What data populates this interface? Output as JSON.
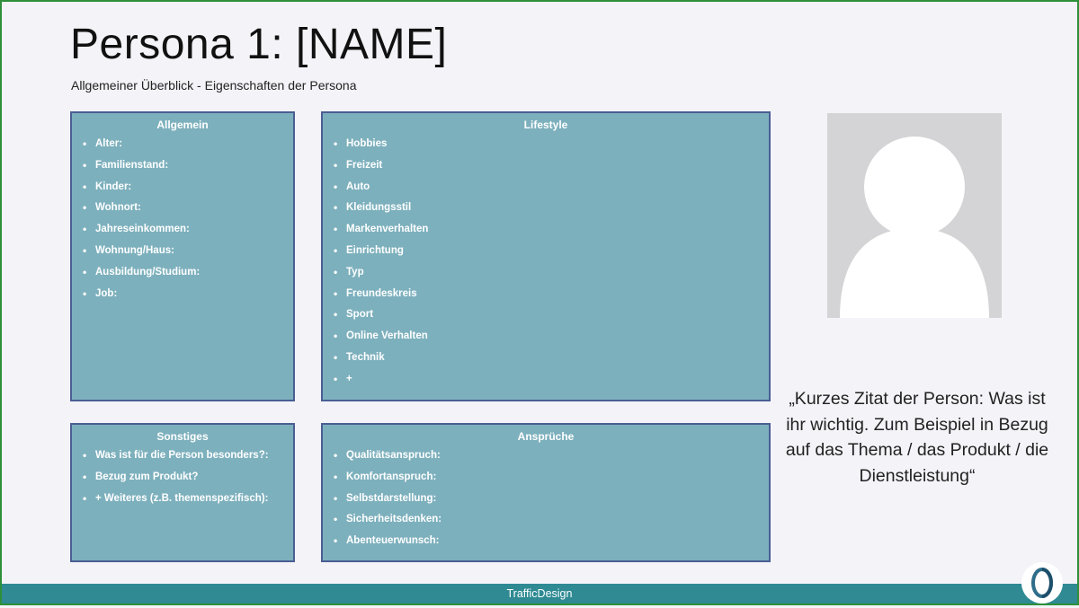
{
  "header": {
    "title": "Persona 1: [NAME]",
    "subtitle": "Allgemeiner Überblick - Eigenschaften der Persona"
  },
  "allgemein": {
    "title": "Allgemein",
    "items": [
      "Alter:",
      "Familienstand:",
      "Kinder:",
      "Wohnort:",
      "Jahreseinkommen:",
      "Wohnung/Haus:",
      "Ausbildung/Studium:",
      "Job:"
    ]
  },
  "lifestyle": {
    "title": "Lifestyle",
    "items": [
      "Hobbies",
      "Freizeit",
      "Auto",
      "Kleidungsstil",
      "Markenverhalten",
      "Einrichtung",
      "Typ",
      "Freundeskreis",
      "Sport",
      "Online Verhalten",
      "Technik",
      "+"
    ]
  },
  "sonstiges": {
    "title": "Sonstiges",
    "items": [
      "Was ist für die Person besonders?:",
      "Bezug zum Produkt?",
      "+ Weiteres (z.B. themenspezifisch):"
    ]
  },
  "ansprueche": {
    "title": "Ansprüche",
    "items": [
      "Qualitätsanspruch:",
      "Komfortanspruch:",
      "Selbstdarstellung:",
      "Sicherheitsdenken:",
      "Abenteuerwunsch:"
    ]
  },
  "quote": "„Kurzes Zitat der Person: Was ist ihr wichtig. Zum Beispiel in Bezug auf das Thema / das Produkt / die Dienstleistung“",
  "footer": {
    "label": "TrafficDesign"
  },
  "colors": {
    "box_fill": "#7db0bd",
    "box_border": "#4a5e93",
    "footer": "#2f8a93",
    "logo_ring": "#2f6e8a"
  },
  "icons": {
    "avatar": "person-placeholder-icon",
    "logo": "trafficdesign-logo-icon"
  }
}
